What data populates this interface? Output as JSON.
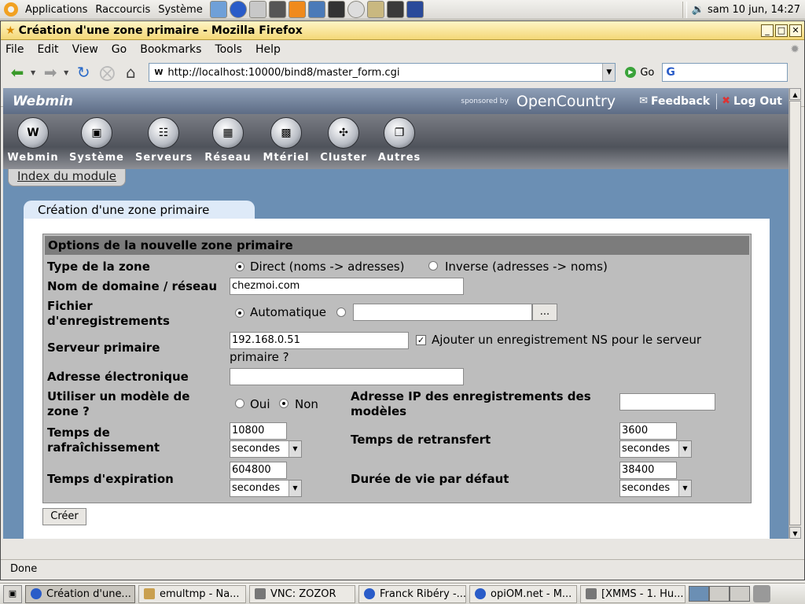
{
  "top_panel": {
    "menus": [
      "Applications",
      "Raccourcis",
      "Système"
    ],
    "clock": "sam 10 jun, 14:27"
  },
  "window": {
    "title": "Création d'une zone primaire - Mozilla Firefox"
  },
  "menubar": [
    "File",
    "Edit",
    "View",
    "Go",
    "Bookmarks",
    "Tools",
    "Help"
  ],
  "navbar": {
    "url": "http://localhost:10000/bind8/master_form.cgi",
    "go_label": "Go"
  },
  "webmin": {
    "logo": "Webmin",
    "sponsored_by": "sponsored by",
    "sponsor_name": "OpenCountry",
    "feedback": "Feedback",
    "logout": "Log Out",
    "categories": [
      "Webmin",
      "Système",
      "Serveurs",
      "Réseau",
      "Mtériel",
      "Cluster",
      "Autres"
    ],
    "module_index": "Index du module"
  },
  "form": {
    "page_title": "Création d'une zone primaire",
    "section_title": "Options de la nouvelle zone primaire",
    "zone_type_label": "Type de la zone",
    "zone_type_direct": "Direct (noms -> adresses)",
    "zone_type_inverse": "Inverse (adresses -> noms)",
    "domain_label": "Nom de domaine / réseau",
    "domain_value": "chezmoi.com",
    "records_file_label_1": "Fichier",
    "records_file_label_2": "d'enregistrements",
    "records_file_auto": "Automatique",
    "browse_label": "...",
    "primary_server_label": "Serveur primaire",
    "primary_server_value": "192.168.0.51",
    "add_ns_label_1": "Ajouter un enregistrement NS pour le serveur",
    "add_ns_label_2": "primaire ?",
    "email_label": "Adresse électronique",
    "email_value": "",
    "template_label_1": "Utiliser un modèle de",
    "template_label_2": "zone ?",
    "template_yes": "Oui",
    "template_no": "Non",
    "template_ip_label_1": "Adresse IP des enregistrements des",
    "template_ip_label_2": "modèles",
    "template_ip_value": "",
    "refresh_label_1": "Temps de",
    "refresh_label_2": "rafraîchissement",
    "refresh_value": "10800",
    "refresh_unit": "secondes",
    "retry_label": "Temps de retransfert",
    "retry_value": "3600",
    "retry_unit": "secondes",
    "expire_label": "Temps d'expiration",
    "expire_value": "604800",
    "expire_unit": "secondes",
    "ttl_label": "Durée de vie par défaut",
    "ttl_value": "38400",
    "ttl_unit": "secondes",
    "create_button": "Créer"
  },
  "status": "Done",
  "taskbar": [
    "Création d'une...",
    "emultmp - Na...",
    "VNC: ZOZOR",
    "Franck Ribéry -...",
    "opiOM.net - M...",
    "[XMMS - 1. Hu..."
  ]
}
